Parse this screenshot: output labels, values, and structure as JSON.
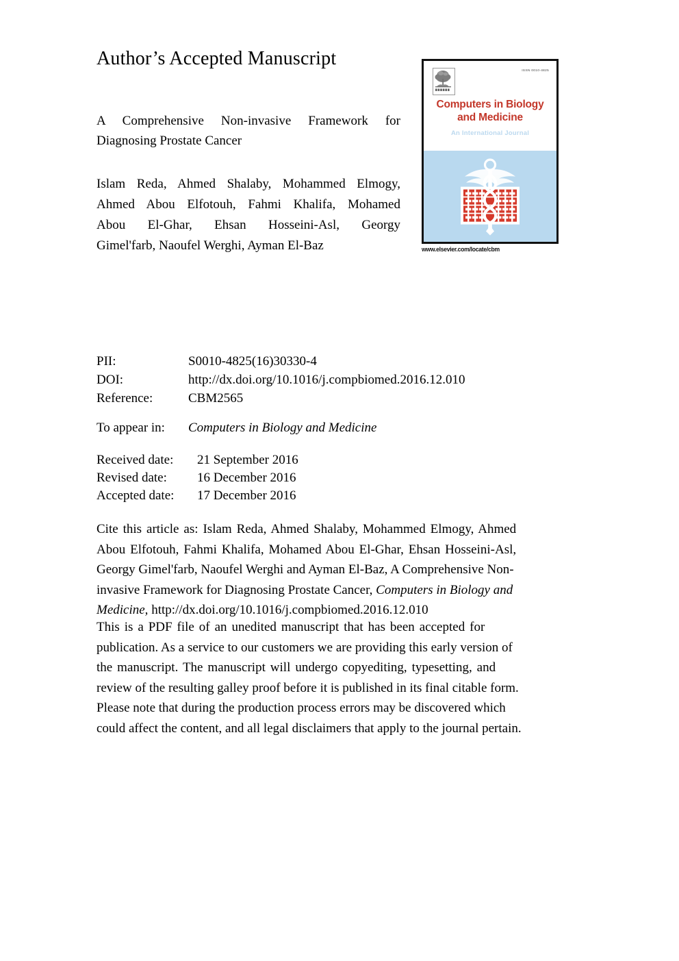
{
  "document": {
    "headline": "Author’s Accepted Manuscript",
    "article_title_line1": "A Comprehensive Non-invasive Framework for",
    "article_title_line2": "Diagnosing Prostate Cancer",
    "authors_line1": "Islam Reda, Ahmed Shalaby, Mohammed Elmogy,",
    "authors_line2": "Ahmed Abou Elfotouh, Fahmi Khalifa, Mohamed",
    "authors_line3": "Abou El-Ghar, Ehsan Hosseini-Asl, Georgy",
    "authors_line4": "Gimel'farb, Naoufel Werghi, Ayman El-Baz"
  },
  "metadata": {
    "pii_label": "PII:",
    "pii_value": "S0010-4825(16)30330-4",
    "doi_label": "DOI:",
    "doi_value": "http://dx.doi.org/10.1016/j.compbiomed.2016.12.010",
    "reference_label": "Reference:",
    "reference_value": "CBM2565"
  },
  "to_appear_in": {
    "label": "To appear in:",
    "journal": "Computers in Biology and Medicine"
  },
  "dates": {
    "received_label": "Received date:",
    "received_value": "21 September 2016",
    "revised_label": "Revised date:",
    "revised_value": "16 December 2016",
    "accepted_label": "Accepted date:",
    "accepted_value": "17 December 2016"
  },
  "citation": {
    "line1": "Cite this article as: Islam Reda, Ahmed Shalaby, Mohammed Elmogy, Ahmed",
    "line2": "Abou Elfotouh, Fahmi Khalifa, Mohamed Abou El-Ghar, Ehsan Hosseini-Asl,",
    "line3": "Georgy Gimel'farb, Naoufel Werghi and Ayman El-Baz, A Comprehensive Non-",
    "line4_plain": "invasive Framework for Diagnosing Prostate Cancer, ",
    "line4_italic": "Computers in Biology and",
    "line5_italic": "Medicine,",
    "line5_plain": " http://dx.doi.org/10.1016/j.compbiomed.2016.12.010"
  },
  "disclaimer": {
    "line1": "This is a PDF file of an unedited manuscript that has been accepted for",
    "line2": "publication. As a service to our customers we are providing this early version of",
    "line3": "the manuscript. The manuscript will undergo copyediting, typesetting, and",
    "line4": "review of the resulting galley proof before it is published in its final citable form.",
    "line5": "Please note that during the production process errors may be discovered which",
    "line6": "could affect the content, and all legal disclaimers that apply to the journal pertain."
  },
  "journal_cover": {
    "title_line1": "Computers in Biology",
    "title_line2": "and Medicine",
    "subtitle": "An International Journal",
    "issn": "ISSN 0010-4825",
    "publisher_logo": "elsevier-tree-logo",
    "emblem": "caduceus-abacus-emblem",
    "url": "www.elsevier.com/locate/cbm",
    "colors": {
      "title_red": "#c3372a",
      "panel_blue": "#b9d9ef",
      "emblem_red": "#d5382a",
      "subtitle_blue": "#bcd9ef"
    }
  }
}
